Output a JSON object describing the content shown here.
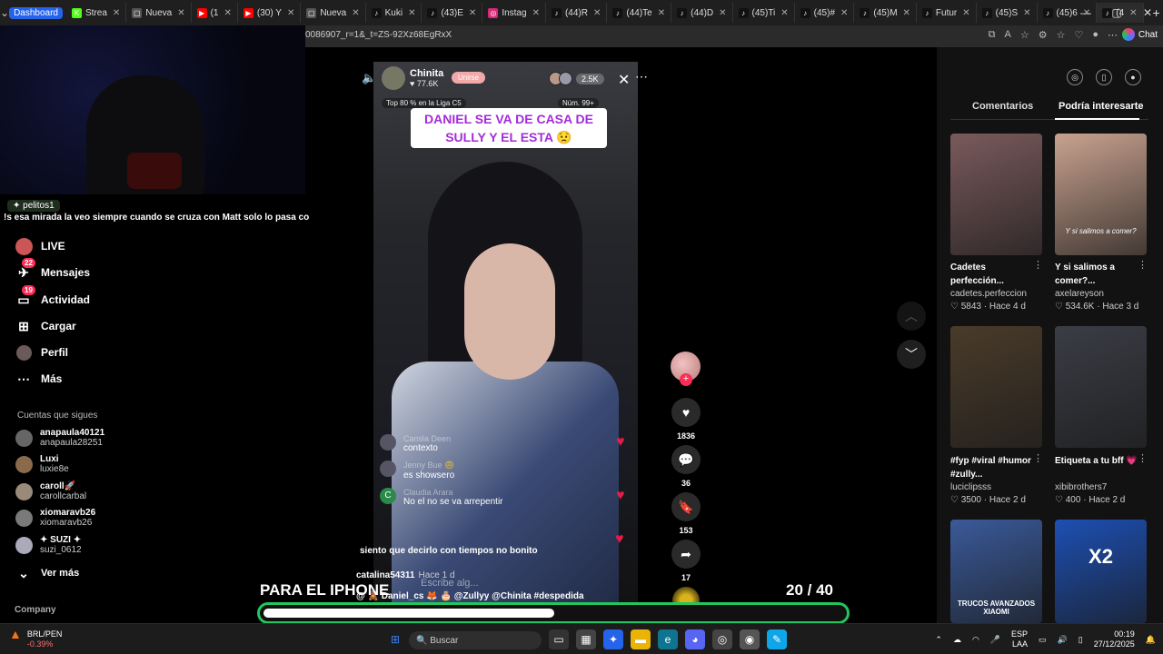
{
  "browser": {
    "dashboard_chip": "Dashboard",
    "tabs": [
      {
        "label": "Strea",
        "icon": "K",
        "color": "#53fc18"
      },
      {
        "label": "Nueva",
        "icon": "▢",
        "color": "#555555"
      },
      {
        "label": "(1",
        "icon": "▶",
        "color": "#ff0000"
      },
      {
        "label": "(30) Y",
        "icon": "▶",
        "color": "#ff0000"
      },
      {
        "label": "Nueva",
        "icon": "▢",
        "color": "#555555"
      },
      {
        "label": "Kuki",
        "icon": "♪",
        "color": "#111111"
      },
      {
        "label": "(43)E",
        "icon": "♪",
        "color": "#111111"
      },
      {
        "label": "Instag",
        "icon": "◎",
        "color": "#d62976"
      },
      {
        "label": "(44)R",
        "icon": "♪",
        "color": "#111111"
      },
      {
        "label": "(44)Te",
        "icon": "♪",
        "color": "#111111"
      },
      {
        "label": "(44)D",
        "icon": "♪",
        "color": "#111111"
      },
      {
        "label": "(45)Ti",
        "icon": "♪",
        "color": "#111111"
      },
      {
        "label": "(45)#",
        "icon": "♪",
        "color": "#111111"
      },
      {
        "label": "(45)M",
        "icon": "♪",
        "color": "#111111"
      },
      {
        "label": "Futur",
        "icon": "♪",
        "color": "#111111"
      },
      {
        "label": "(45)S",
        "icon": "♪",
        "color": "#111111"
      },
      {
        "label": "(45)6",
        "icon": "♪",
        "color": "#111111"
      },
      {
        "label": "(4",
        "icon": "♪",
        "color": "#111111"
      }
    ],
    "url_fragment": "0086907_r=1&_t=ZS-92Xz68EgRxX",
    "chat_label": "Chat"
  },
  "stream_chat": {
    "username": "pelitos1",
    "message": "!s esa mirada la veo siempre cuando se cruza con Matt solo lo pasa con chicle"
  },
  "sidebar": {
    "nav": [
      {
        "label": "LIVE",
        "icon": "live-icon",
        "badge": ""
      },
      {
        "label": "Mensajes",
        "icon": "message-icon",
        "badge": "22"
      },
      {
        "label": "Actividad",
        "icon": "activity-icon",
        "badge": "19"
      },
      {
        "label": "Cargar",
        "icon": "upload-icon",
        "badge": ""
      },
      {
        "label": "Perfil",
        "icon": "profile-icon",
        "badge": ""
      },
      {
        "label": "Más",
        "icon": "more-icon",
        "badge": ""
      }
    ],
    "following_title": "Cuentas que sigues",
    "following": [
      {
        "name": "anapaula40121",
        "handle": "anapaula28251"
      },
      {
        "name": "Luxi",
        "handle": "luxie8e"
      },
      {
        "name": "caroll🚀",
        "handle": "carollcarbal"
      },
      {
        "name": "xiomaravb26",
        "handle": "xiomaravb26"
      },
      {
        "name": "✦ SUZI ✦",
        "handle": "suzi_0612"
      }
    ],
    "see_more": "Ver más",
    "company": "Company"
  },
  "live": {
    "host_name": "Chinita",
    "host_likes": "♥ 77.6K",
    "join_label": "Unirse",
    "viewer_count": "2.5K",
    "ranking": "Top 80 % en la Liga C5",
    "rank_number": "Núm. 99+",
    "caption": "DANIEL SE VA DE CASA DE SULLY Y EL ESTA 😟",
    "comments": [
      {
        "user": "Camila Deen",
        "text": "contexto",
        "avatar": ""
      },
      {
        "user": "Jenny Bue 😊",
        "text": "es showsero",
        "avatar": ""
      },
      {
        "user": "Claudia Arara",
        "text": "No el no se va arrepentir",
        "avatar": "C"
      }
    ],
    "overlay_text": "siento que decirlo con tiempos no bonito",
    "author": "catalina54311",
    "time": "Hace 1 d",
    "placeholder": "Escribe alg...",
    "tags": "@ 🧸 Daniel_cs 🦊 🎂 @Zullyy @Chinita #despedida"
  },
  "actions": {
    "likes": "1836",
    "comments": "36",
    "saves": "153",
    "shares": "17"
  },
  "overlay": {
    "title": "PARA EL IPHONE",
    "counter": "20  / 40",
    "progress": 0.5
  },
  "right_panel": {
    "tab_comments": "Comentarios",
    "tab_interesting": "Podría interesarte",
    "cards": [
      {
        "title": "Cadetes perfección...",
        "user": "cadetes.perfeccion",
        "likes": "5843",
        "time": "Hace 4 d",
        "thumb_text": "",
        "bg": "#7a5a5c"
      },
      {
        "title": "Y si salimos a comer?...",
        "user": "axelareyson",
        "likes": "534.6K",
        "time": "Hace 3 d",
        "thumb_text": "Y si salimos a comer?",
        "bg": "#c9a28f"
      },
      {
        "title": "#fyp #viral #humor #zully...",
        "user": "luciclipsss",
        "likes": "3500",
        "time": "Hace 2 d",
        "thumb_text": "",
        "bg": "#4a3b2a"
      },
      {
        "title": "Etiqueta a tu bff 💗",
        "user": "xibibrothers7",
        "likes": "400",
        "time": "Hace 2 d",
        "thumb_text": "",
        "bg": "#3b3d45"
      },
      {
        "title": "",
        "user": "",
        "likes": "",
        "time": "",
        "thumb_text": "TRUCOS AVANZADOS XIAOMI",
        "bg": "#3a5a9a"
      },
      {
        "title": "",
        "user": "",
        "likes": "",
        "time": "",
        "thumb_text": "X2",
        "bg": "#1d4fb3"
      }
    ]
  },
  "taskbar": {
    "stock_name": "BRL/PEN",
    "stock_change": "-0.39%",
    "search_label": "Buscar",
    "lang": "ESP",
    "lang2": "LAA",
    "time": "00:19",
    "date": "27/12/2025"
  }
}
